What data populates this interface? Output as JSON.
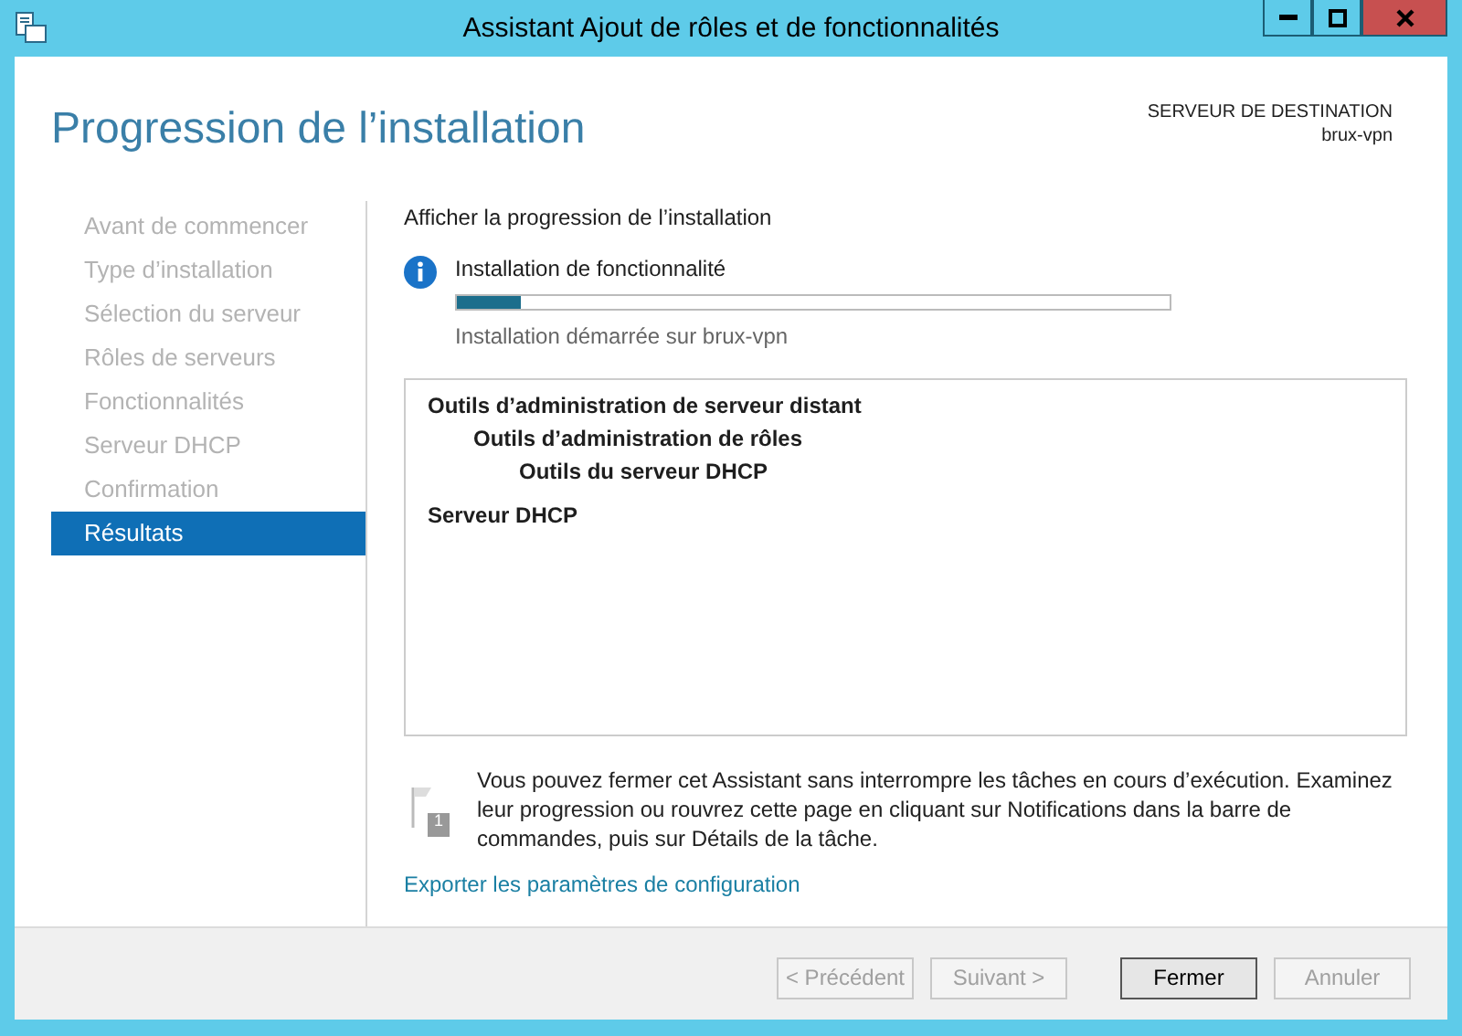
{
  "window": {
    "title": "Assistant Ajout de rôles et de fonctionnalités"
  },
  "page_title": "Progression de l’installation",
  "destination": {
    "label": "SERVEUR DE DESTINATION",
    "server": "brux-vpn"
  },
  "sidebar": {
    "items": [
      {
        "label": "Avant de commencer",
        "selected": false
      },
      {
        "label": "Type d’installation",
        "selected": false
      },
      {
        "label": "Sélection du serveur",
        "selected": false
      },
      {
        "label": "Rôles de serveurs",
        "selected": false
      },
      {
        "label": "Fonctionnalités",
        "selected": false
      },
      {
        "label": "Serveur DHCP",
        "selected": false
      },
      {
        "label": "Confirmation",
        "selected": false
      },
      {
        "label": "Résultats",
        "selected": true
      }
    ]
  },
  "section_label": "Afficher la progression de l’installation",
  "progress": {
    "title": "Installation de fonctionnalité",
    "level": 0.09,
    "status": "Installation démarrée sur brux-vpn"
  },
  "features": [
    {
      "label": "Outils d’administration de serveur distant",
      "children": [
        {
          "label": "Outils d’administration de rôles",
          "children": [
            {
              "label": "Outils du serveur DHCP"
            }
          ]
        }
      ]
    },
    {
      "label": "Serveur DHCP"
    }
  ],
  "notice": "Vous pouvez fermer cet Assistant sans interrompre les tâches en cours d’exécution. Examinez leur progression ou rouvrez cette page en cliquant sur Notifications dans la barre de commandes, puis sur Détails de la tâche.",
  "notice_badge": "1",
  "export_link": "Exporter les paramètres de configuration",
  "buttons": [
    {
      "label": "< Précédent",
      "disabled": true,
      "default": false
    },
    {
      "label": "Suivant >",
      "disabled": true,
      "default": false
    },
    {
      "label": "Fermer",
      "disabled": false,
      "default": true
    },
    {
      "label": "Annuler",
      "disabled": true,
      "default": false
    }
  ]
}
